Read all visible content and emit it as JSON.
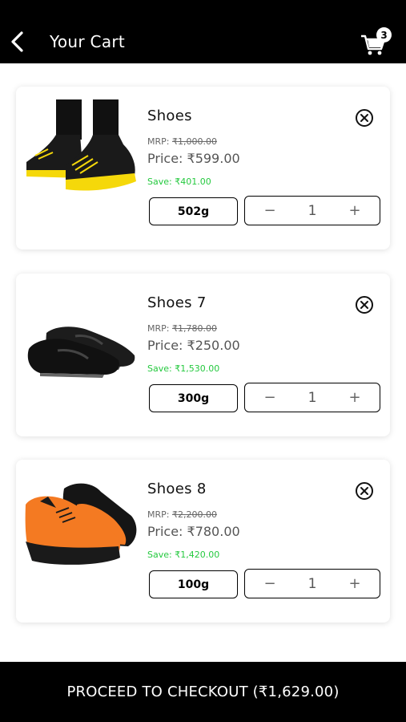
{
  "header": {
    "back_icon": "chevron-left-icon",
    "title": "Your Cart",
    "cart_icon": "shopping-cart-icon",
    "cart_count": "3"
  },
  "cart": {
    "items": [
      {
        "name": "Shoes",
        "mrp_label": "MRP: ",
        "mrp_value": "₹1,000.00",
        "price": "Price: ₹599.00",
        "save": "Save: ₹401.00",
        "weight": "502g",
        "quantity": "1",
        "image_icon": "black-yellow-sneaker-image"
      },
      {
        "name": "Shoes 7",
        "mrp_label": "MRP: ",
        "mrp_value": "₹1,780.00",
        "price": "Price: ₹250.00",
        "save": "Save: ₹1,530.00",
        "weight": "300g",
        "quantity": "1",
        "image_icon": "black-loafer-image"
      },
      {
        "name": "Shoes 8",
        "mrp_label": "MRP: ",
        "mrp_value": "₹2,200.00",
        "price": "Price: ₹780.00",
        "save": "Save: ₹1,420.00",
        "weight": "100g",
        "quantity": "1",
        "image_icon": "orange-black-sneaker-image"
      }
    ],
    "remove_icon": "circle-close-icon",
    "minus_symbol": "−",
    "plus_symbol": "+"
  },
  "footer": {
    "checkout_label": "PROCEED TO CHECKOUT (₹1,629.00)"
  },
  "colors": {
    "header_bg": "#000000",
    "save_green": "#25c93f",
    "footer_bg": "#000000"
  }
}
